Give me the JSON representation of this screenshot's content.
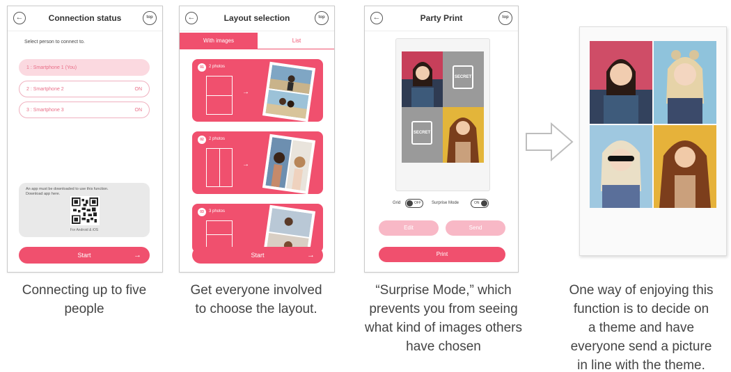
{
  "panel1": {
    "title": "Connection status",
    "top_icon_text": "top",
    "prompt": "Select person to connect to.",
    "persons": [
      {
        "label": "1 : Smartphone 1 (You)",
        "status": ""
      },
      {
        "label": "2 : Smartphone 2",
        "status": "ON"
      },
      {
        "label": "3 : Smartphone 3",
        "status": "ON"
      }
    ],
    "download_text": "An app must be downloaded to use this function. Download app here.",
    "download_footer": "For Android & iOS",
    "start_label": "Start"
  },
  "panel2": {
    "title": "Layout selection",
    "top_icon_text": "top",
    "tabs": [
      {
        "label": "With images"
      },
      {
        "label": "List"
      }
    ],
    "layouts": [
      {
        "badge": "01",
        "name": "2 photos"
      },
      {
        "badge": "02",
        "name": "2 photos"
      },
      {
        "badge": "03",
        "name": "3 photos"
      }
    ],
    "start_label": "Start"
  },
  "panel3": {
    "title": "Party Print",
    "top_icon_text": "top",
    "secret_label": "SECRET",
    "grid_label": "Grid",
    "grid_state": "OFF",
    "surprise_label": "Surprise Mode",
    "surprise_state": "ON",
    "edit_label": "Edit",
    "send_label": "Send",
    "print_label": "Print"
  },
  "captions": {
    "c1": [
      "Connecting up to five",
      "people"
    ],
    "c2": [
      "Get everyone involved",
      "to choose the layout."
    ],
    "c3": [
      "“Surprise Mode,” which",
      "prevents you from seeing",
      "what kind of images others",
      "have chosen"
    ],
    "c4": [
      "One way of enjoying this",
      "function is to decide on",
      "a theme and have",
      "everyone send a picture",
      "in line with the theme."
    ]
  },
  "colors": {
    "accent": "#f0506e",
    "accent_light": "#f8b8c6"
  }
}
